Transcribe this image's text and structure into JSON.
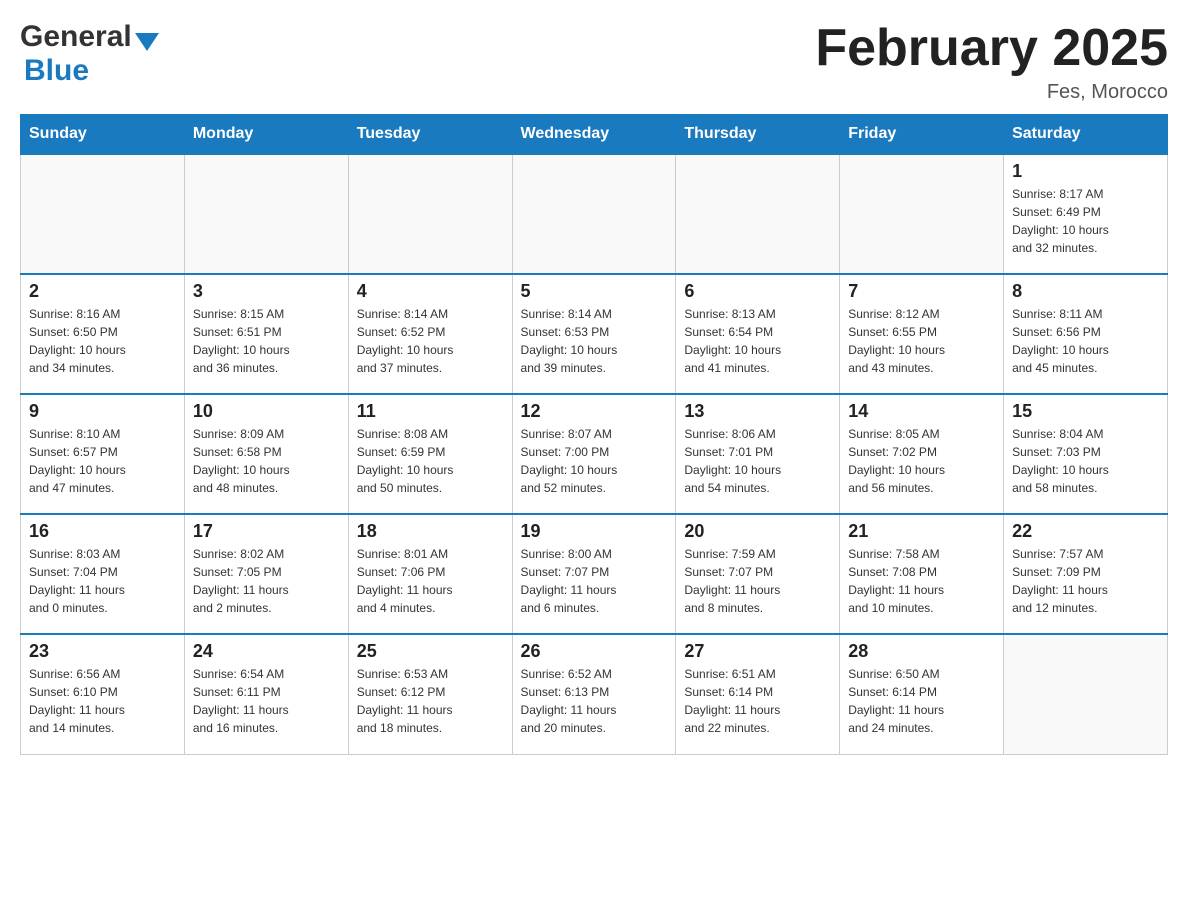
{
  "header": {
    "title": "February 2025",
    "location": "Fes, Morocco"
  },
  "logo": {
    "general": "General",
    "blue": "Blue"
  },
  "days_of_week": [
    "Sunday",
    "Monday",
    "Tuesday",
    "Wednesday",
    "Thursday",
    "Friday",
    "Saturday"
  ],
  "weeks": [
    {
      "days": [
        {
          "date": "",
          "info": ""
        },
        {
          "date": "",
          "info": ""
        },
        {
          "date": "",
          "info": ""
        },
        {
          "date": "",
          "info": ""
        },
        {
          "date": "",
          "info": ""
        },
        {
          "date": "",
          "info": ""
        },
        {
          "date": "1",
          "info": "Sunrise: 8:17 AM\nSunset: 6:49 PM\nDaylight: 10 hours\nand 32 minutes."
        }
      ]
    },
    {
      "days": [
        {
          "date": "2",
          "info": "Sunrise: 8:16 AM\nSunset: 6:50 PM\nDaylight: 10 hours\nand 34 minutes."
        },
        {
          "date": "3",
          "info": "Sunrise: 8:15 AM\nSunset: 6:51 PM\nDaylight: 10 hours\nand 36 minutes."
        },
        {
          "date": "4",
          "info": "Sunrise: 8:14 AM\nSunset: 6:52 PM\nDaylight: 10 hours\nand 37 minutes."
        },
        {
          "date": "5",
          "info": "Sunrise: 8:14 AM\nSunset: 6:53 PM\nDaylight: 10 hours\nand 39 minutes."
        },
        {
          "date": "6",
          "info": "Sunrise: 8:13 AM\nSunset: 6:54 PM\nDaylight: 10 hours\nand 41 minutes."
        },
        {
          "date": "7",
          "info": "Sunrise: 8:12 AM\nSunset: 6:55 PM\nDaylight: 10 hours\nand 43 minutes."
        },
        {
          "date": "8",
          "info": "Sunrise: 8:11 AM\nSunset: 6:56 PM\nDaylight: 10 hours\nand 45 minutes."
        }
      ]
    },
    {
      "days": [
        {
          "date": "9",
          "info": "Sunrise: 8:10 AM\nSunset: 6:57 PM\nDaylight: 10 hours\nand 47 minutes."
        },
        {
          "date": "10",
          "info": "Sunrise: 8:09 AM\nSunset: 6:58 PM\nDaylight: 10 hours\nand 48 minutes."
        },
        {
          "date": "11",
          "info": "Sunrise: 8:08 AM\nSunset: 6:59 PM\nDaylight: 10 hours\nand 50 minutes."
        },
        {
          "date": "12",
          "info": "Sunrise: 8:07 AM\nSunset: 7:00 PM\nDaylight: 10 hours\nand 52 minutes."
        },
        {
          "date": "13",
          "info": "Sunrise: 8:06 AM\nSunset: 7:01 PM\nDaylight: 10 hours\nand 54 minutes."
        },
        {
          "date": "14",
          "info": "Sunrise: 8:05 AM\nSunset: 7:02 PM\nDaylight: 10 hours\nand 56 minutes."
        },
        {
          "date": "15",
          "info": "Sunrise: 8:04 AM\nSunset: 7:03 PM\nDaylight: 10 hours\nand 58 minutes."
        }
      ]
    },
    {
      "days": [
        {
          "date": "16",
          "info": "Sunrise: 8:03 AM\nSunset: 7:04 PM\nDaylight: 11 hours\nand 0 minutes."
        },
        {
          "date": "17",
          "info": "Sunrise: 8:02 AM\nSunset: 7:05 PM\nDaylight: 11 hours\nand 2 minutes."
        },
        {
          "date": "18",
          "info": "Sunrise: 8:01 AM\nSunset: 7:06 PM\nDaylight: 11 hours\nand 4 minutes."
        },
        {
          "date": "19",
          "info": "Sunrise: 8:00 AM\nSunset: 7:07 PM\nDaylight: 11 hours\nand 6 minutes."
        },
        {
          "date": "20",
          "info": "Sunrise: 7:59 AM\nSunset: 7:07 PM\nDaylight: 11 hours\nand 8 minutes."
        },
        {
          "date": "21",
          "info": "Sunrise: 7:58 AM\nSunset: 7:08 PM\nDaylight: 11 hours\nand 10 minutes."
        },
        {
          "date": "22",
          "info": "Sunrise: 7:57 AM\nSunset: 7:09 PM\nDaylight: 11 hours\nand 12 minutes."
        }
      ]
    },
    {
      "days": [
        {
          "date": "23",
          "info": "Sunrise: 6:56 AM\nSunset: 6:10 PM\nDaylight: 11 hours\nand 14 minutes."
        },
        {
          "date": "24",
          "info": "Sunrise: 6:54 AM\nSunset: 6:11 PM\nDaylight: 11 hours\nand 16 minutes."
        },
        {
          "date": "25",
          "info": "Sunrise: 6:53 AM\nSunset: 6:12 PM\nDaylight: 11 hours\nand 18 minutes."
        },
        {
          "date": "26",
          "info": "Sunrise: 6:52 AM\nSunset: 6:13 PM\nDaylight: 11 hours\nand 20 minutes."
        },
        {
          "date": "27",
          "info": "Sunrise: 6:51 AM\nSunset: 6:14 PM\nDaylight: 11 hours\nand 22 minutes."
        },
        {
          "date": "28",
          "info": "Sunrise: 6:50 AM\nSunset: 6:14 PM\nDaylight: 11 hours\nand 24 minutes."
        },
        {
          "date": "",
          "info": ""
        }
      ]
    }
  ]
}
